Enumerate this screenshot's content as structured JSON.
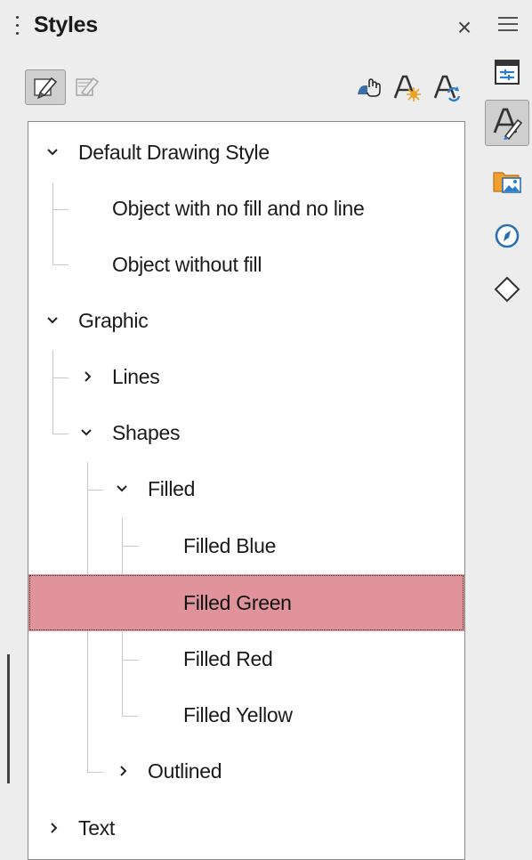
{
  "panel": {
    "title": "Styles",
    "close_glyph": "×",
    "menu_icon": "hamburger-menu-icon"
  },
  "toolbar": {
    "left_tools": [
      {
        "icon": "drawing-styles-icon",
        "pressed": true
      },
      {
        "icon": "presentation-styles-icon",
        "pressed": false
      }
    ],
    "right_tools": [
      {
        "icon": "fill-format-mode-icon"
      },
      {
        "icon": "new-style-from-selection-icon"
      },
      {
        "icon": "update-style-icon"
      }
    ]
  },
  "tree": {
    "items": [
      {
        "label": "Default Drawing Style",
        "level": 0,
        "expander": "expanded"
      },
      {
        "label": "Object with no fill and no line",
        "level": 1,
        "expander": "none"
      },
      {
        "label": "Object without fill",
        "level": 1,
        "expander": "none"
      },
      {
        "label": "Graphic",
        "level": 0,
        "expander": "expanded"
      },
      {
        "label": "Lines",
        "level": 1,
        "expander": "collapsed"
      },
      {
        "label": "Shapes",
        "level": 1,
        "expander": "expanded"
      },
      {
        "label": "Filled",
        "level": 2,
        "expander": "expanded"
      },
      {
        "label": "Filled Blue",
        "level": 3,
        "expander": "none"
      },
      {
        "label": "Filled Green",
        "level": 3,
        "expander": "none",
        "selected": true
      },
      {
        "label": "Filled Red",
        "level": 3,
        "expander": "none"
      },
      {
        "label": "Filled Yellow",
        "level": 3,
        "expander": "none"
      },
      {
        "label": "Outlined",
        "level": 2,
        "expander": "collapsed"
      },
      {
        "label": "Text",
        "level": 0,
        "expander": "collapsed"
      }
    ],
    "selected_color": "#e0939a"
  },
  "deck": {
    "buttons": [
      {
        "icon": "properties-icon",
        "active": false
      },
      {
        "icon": "styles-icon",
        "active": true
      },
      {
        "icon": "gallery-icon",
        "active": false
      },
      {
        "icon": "navigator-icon",
        "active": false
      },
      {
        "icon": "shapes-icon",
        "active": false
      }
    ]
  }
}
